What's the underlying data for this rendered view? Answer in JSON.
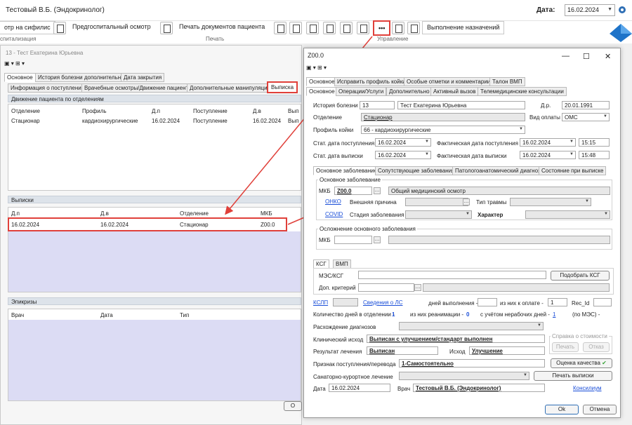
{
  "app": {
    "title": "Тестовый В.Б. (Эндокринолог)",
    "date_label": "Дата:",
    "date_value": "16.02.2024"
  },
  "ribbon": {
    "btn_syphilis": "отр на сифилис",
    "btn_prehospital": "Предгоспитальный осмотр",
    "btn_print_docs": "Печать документов пациента",
    "btn_dots": "•••",
    "btn_exec": "Выполнение назначений",
    "group_hosp": "спитализация",
    "group_print": "Печать",
    "group_manage": "Управление"
  },
  "bg": {
    "title": "13 - Тест Екатерина Юрьевна",
    "tabs1": [
      "Основное",
      "История болезни дополнительно",
      "Дата закрытия"
    ],
    "tabs2": [
      "Информация о поступлении",
      "Врачебные осмотры/Движение пациента",
      "Дополнительные манипуляции",
      "Выписка"
    ],
    "movement": {
      "title": "Движение пациента по отделениям",
      "headers": [
        "Отделение",
        "Профиль",
        "Д.п",
        "Поступление",
        "Д.в",
        "Вып"
      ],
      "row": [
        "Стационар",
        "кардиохирургические",
        "16.02.2024",
        "Поступление",
        "16.02.2024",
        "Вып"
      ]
    },
    "discharges": {
      "title": "Выписки",
      "headers": [
        "Д.п",
        "Д.в",
        "Отделение",
        "МКБ"
      ],
      "row": [
        "16.02.2024",
        "16.02.2024",
        "Стационар",
        "Z00.0"
      ]
    },
    "epicrises": {
      "title": "Эпикризы",
      "headers": [
        "Врач",
        "Дата",
        "Тип"
      ]
    },
    "ok": "О"
  },
  "dlg": {
    "title": "Z00.0",
    "tabs1": [
      "Основное",
      "Исправить профиль койки",
      "Особые отметки и комментарии",
      "Талон ВМП"
    ],
    "tabs2": [
      "Основное",
      "Операции/Услуги",
      "Дополнительно",
      "Активный вызов",
      "Телемедицинские консультации"
    ],
    "history_lbl": "История болезни",
    "history_num": "13",
    "patient": "Тест Екатерина Юрьевна",
    "dob_lbl": "Д.р.",
    "dob": "20.01.1991",
    "dept_lbl": "Отделение",
    "dept": "Стационар",
    "pay_lbl": "Вид оплаты",
    "pay": "ОМС",
    "bed_lbl": "Профиль койки",
    "bed": "66 - кардиохирургические",
    "adm_lbl": "Стат. дата поступления",
    "adm": "16.02.2024",
    "fact_adm_lbl": "Фактическая дата поступления",
    "fact_adm": "16.02.2024",
    "fact_adm_t": "15:15",
    "dis_lbl": "Стат. дата выписки",
    "dis": "16.02.2024",
    "fact_dis_lbl": "Фактическая дата выписки",
    "fact_dis": "16.02.2024",
    "fact_dis_t": "15:48",
    "tabs3": [
      "Основное заболевание",
      "Сопутствующие заболевания",
      "Патологоанатомический диагноз",
      "Состояние при выписке"
    ],
    "main_frame": "Основное заболевание",
    "mkb_lbl": "МКБ",
    "mkb": "Z00.0",
    "mkb_name": "Общий медицинский осмотр",
    "onko": "ОНКО",
    "ext_lbl": "Внешняя причина",
    "trauma_lbl": "Тип травмы",
    "covid": "COVID",
    "stage_lbl": "Стадия заболевания",
    "char_lbl": "Характер",
    "compl_frame": "Осложнение основного заболевания",
    "mkb2_lbl": "МКБ",
    "ksg_tabs": [
      "КСГ",
      "ВМП"
    ],
    "mes_lbl": "МЭС/КСГ",
    "pick_ksg": "Подобрать КСГ",
    "crit_lbl": "Доп. критерий",
    "kslp": "КСЛП",
    "ls": "Сведения о ЛС",
    "days_exec_lbl": "дней выполнения -",
    "pay_of_lbl": "из них к оплате -",
    "pay_of": "1",
    "rec_lbl": "Rec_Id",
    "days_dept_lbl": "Количество дней в отделении -",
    "days_dept": "1",
    "reanim_lbl": "из них реанимации -",
    "reanim": "0",
    "nonwork_lbl": "с учётом нерабочих дней -",
    "nonwork": "1",
    "mes_po": "(по МЭС) -",
    "diverge_lbl": "Расхождение диагнозов",
    "clin_lbl": "Клинический исход",
    "clin": "Выписан с улучшением/стандарт выполнен",
    "calc_frame": "Справка о стоимости",
    "print_btn": "Печать",
    "refuse_btn": "Отказ",
    "result_lbl": "Результат лечения",
    "result": "Выписан",
    "outcome_lbl": "Исход",
    "outcome": "Улучшение",
    "admit_sign_lbl": "Признак поступления/перевода",
    "admit_sign": "1-Самостоятельно",
    "quality_btn": "Оценка качества",
    "sanat_lbl": "Санаторно-курортное лечение",
    "print_dis_btn": "Печать выписки",
    "date_lbl": "Дата",
    "date": "16.02.2024",
    "doctor_lbl": "Врач",
    "doctor": "Тестовый В.Б. (Эндокринолог)",
    "consil": "Консилиум",
    "ok": "Ok",
    "cancel": "Отмена"
  },
  "colors": {
    "highlight": "#e0403a",
    "link": "#1a4ed8",
    "lavender": "#dcdcf4"
  }
}
